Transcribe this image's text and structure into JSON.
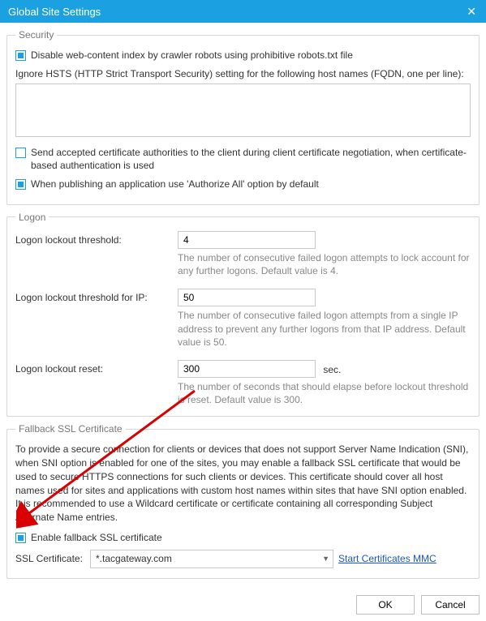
{
  "window": {
    "title": "Global Site Settings"
  },
  "security": {
    "legend": "Security",
    "disable_index_label": "Disable web-content index by crawler robots using prohibitive robots.txt file",
    "hsts_label": "Ignore HSTS (HTTP Strict Transport Security) setting for the following host names (FQDN, one per line):",
    "hsts_value": "",
    "send_ca_label": "Send accepted certificate authorities to the client during client certificate negotiation, when certificate-based authentication is used",
    "authorize_all_label": "When publishing an application use 'Authorize All' option by default"
  },
  "logon": {
    "legend": "Logon",
    "threshold_label": "Logon lockout threshold:",
    "threshold_value": "4",
    "threshold_desc": "The number of consecutive failed logon attempts to lock account for any further logons. Default value is 4.",
    "threshold_ip_label": "Logon lockout threshold for IP:",
    "threshold_ip_value": "50",
    "threshold_ip_desc": "The number of consecutive failed logon attempts from a single IP address to prevent any further logons from that IP address. Default value is 50.",
    "reset_label": "Logon lockout reset:",
    "reset_value": "300",
    "reset_unit": "sec.",
    "reset_desc": "The number of seconds that should elapse before lockout threshold is reset. Default value is 300."
  },
  "fallback": {
    "legend": "Fallback SSL Certificate",
    "text": "To provide a secure connection for clients or devices that does not support Server Name Indication (SNI), when SNI option is enabled for one of the sites, you may enable a fallback SSL certificate that would be used to secure HTTPS connections for such clients or devices. This certificate should cover all host names used for sites and applications with custom host names within sites that have SNI option enabled. It is recommended to use a Wildcard certificate or certificate containing all corresponding Subject Alternate Name entries.",
    "enable_label": "Enable fallback SSL certificate",
    "cert_label": "SSL Certificate:",
    "cert_value": "*.tacgateway.com",
    "mmc_link": "Start Certificates MMC"
  },
  "buttons": {
    "ok": "OK",
    "cancel": "Cancel"
  }
}
